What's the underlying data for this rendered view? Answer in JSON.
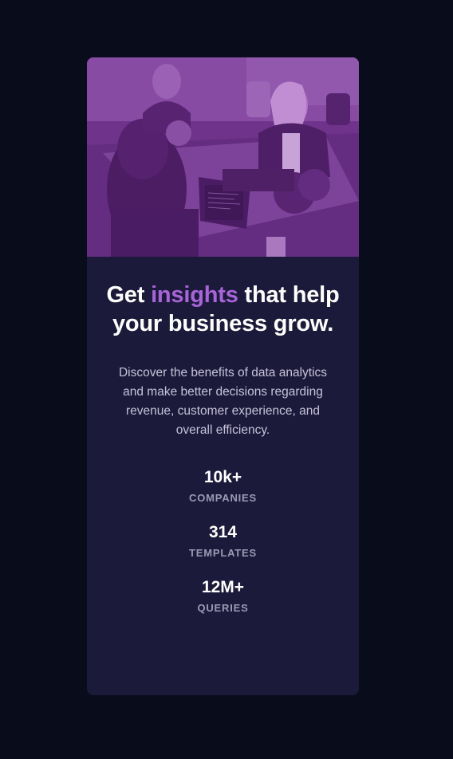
{
  "card": {
    "title_before": "Get ",
    "title_accent": "insights",
    "title_after": " that help your business grow.",
    "description": "Discover the benefits of data analytics and make better decisions regarding revenue, customer experience, and overall efficiency.",
    "stats": [
      {
        "value": "10k+",
        "label": "COMPANIES"
      },
      {
        "value": "314",
        "label": "TEMPLATES"
      },
      {
        "value": "12M+",
        "label": "QUERIES"
      }
    ]
  },
  "colors": {
    "page_background": "#090c1b",
    "card_background": "#1c1a3a",
    "accent": "#a864d9",
    "image_overlay": "#7a3e9d",
    "label_text": "#9c99b4"
  },
  "icons": {
    "hero": "office-team-photo"
  }
}
